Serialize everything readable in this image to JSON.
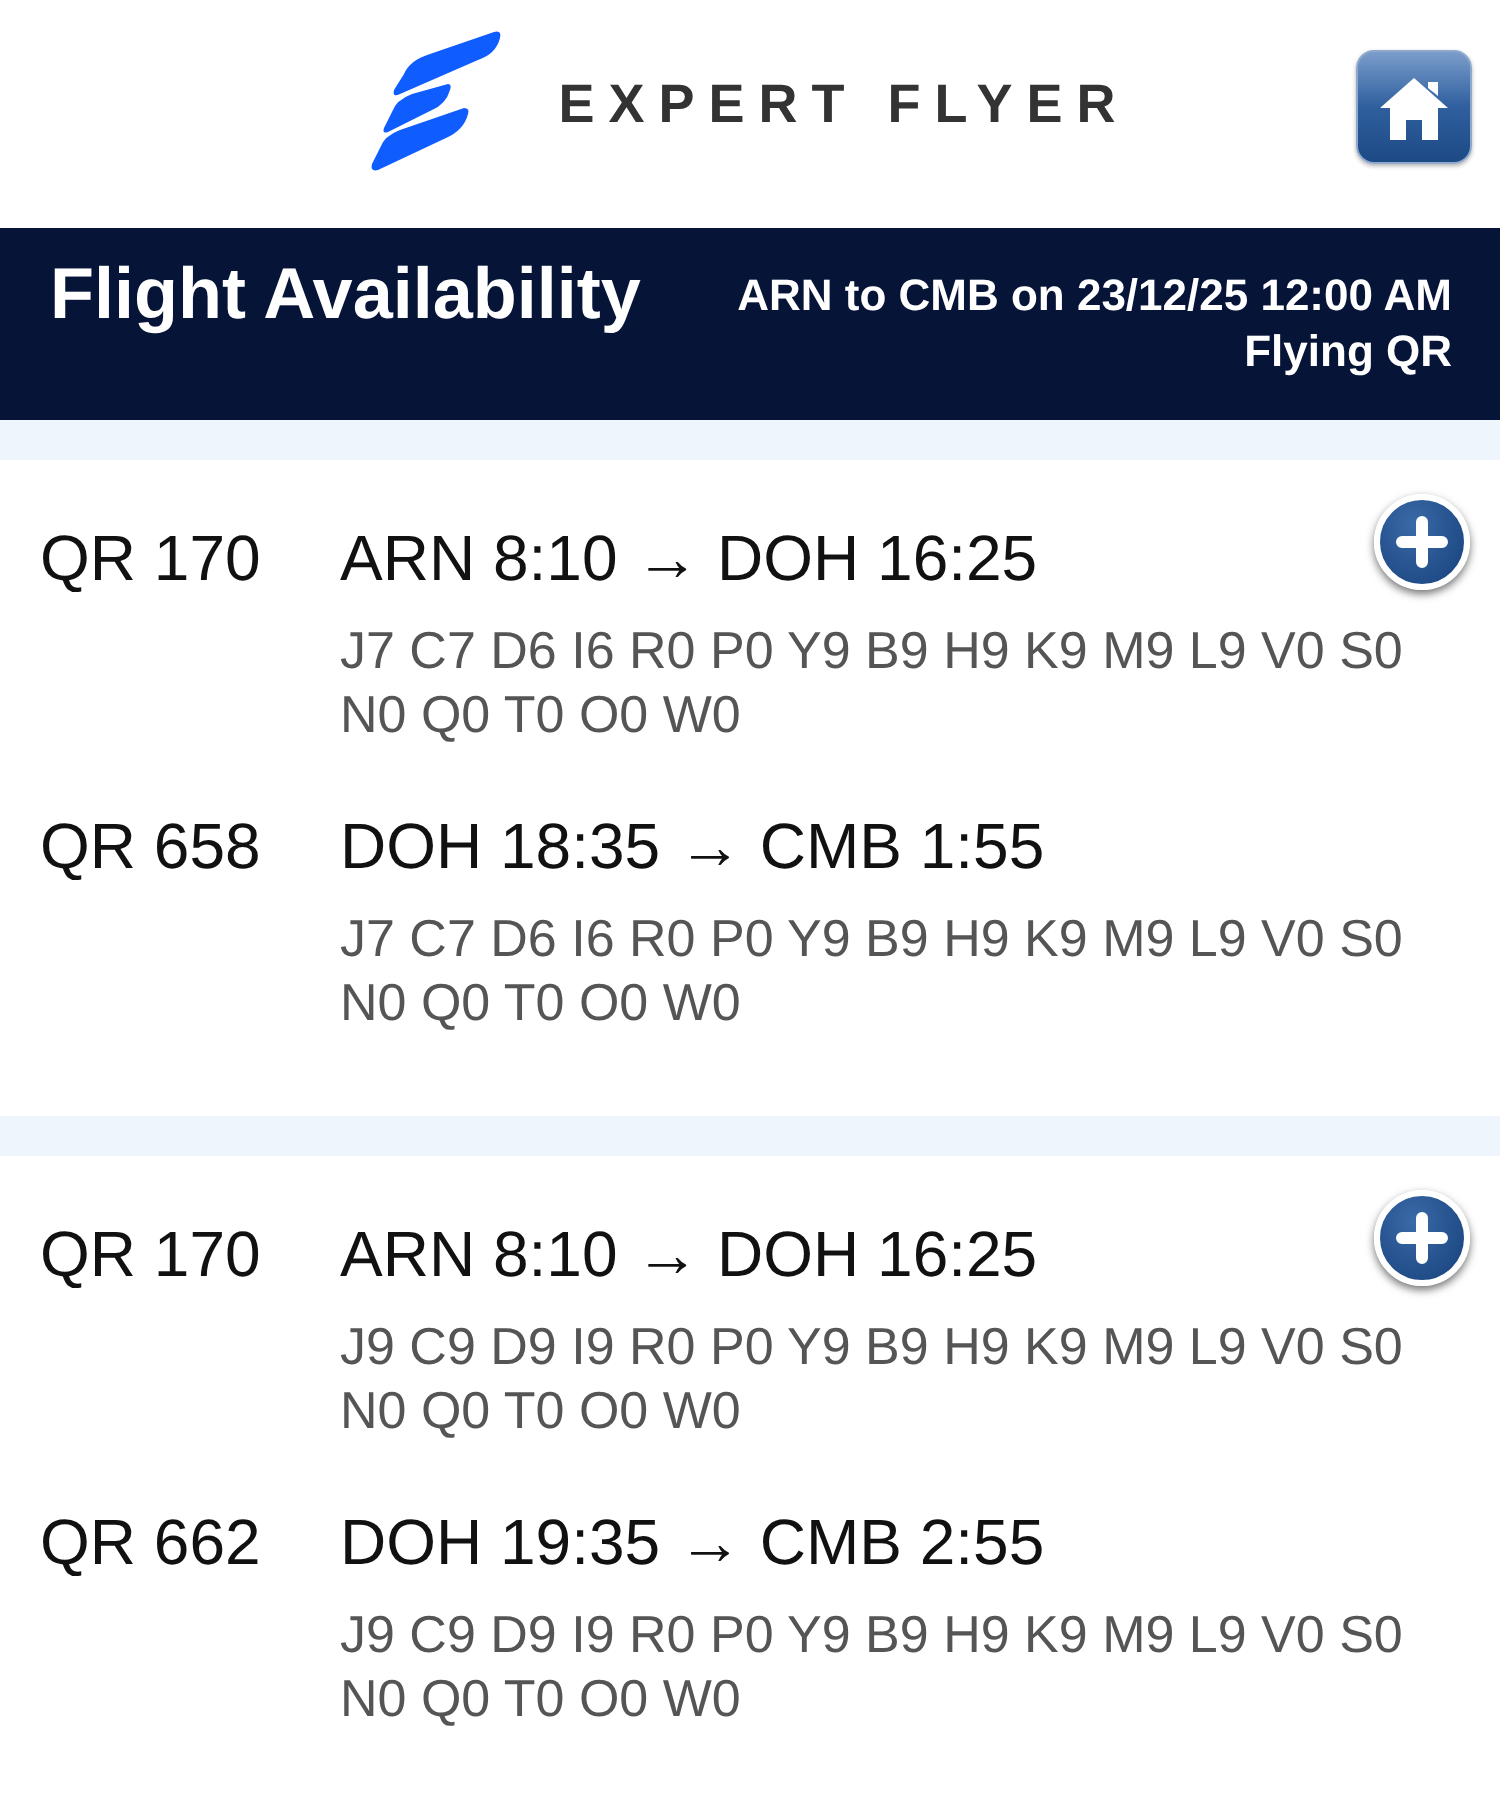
{
  "header": {
    "brand": "EXPERT FLYER"
  },
  "title_bar": {
    "title": "Flight Availability",
    "route": "ARN to CMB on 23/12/25 12:00 AM",
    "carrier": "Flying QR"
  },
  "itineraries": [
    {
      "segments": [
        {
          "flight": "QR 170",
          "route": "ARN 8:10 → DOH 16:25",
          "classes": "J7 C7 D6 I6 R0 P0 Y9 B9 H9 K9 M9 L9 V0 S0 N0 Q0 T0 O0 W0"
        },
        {
          "flight": "QR 658",
          "route": "DOH 18:35 → CMB 1:55",
          "classes": "J7 C7 D6 I6 R0 P0 Y9 B9 H9 K9 M9 L9 V0 S0 N0 Q0 T0 O0 W0"
        }
      ]
    },
    {
      "segments": [
        {
          "flight": "QR 170",
          "route": "ARN 8:10 → DOH 16:25",
          "classes": "J9 C9 D9 I9 R0 P0 Y9 B9 H9 K9 M9 L9 V0 S0 N0 Q0 T0 O0 W0"
        },
        {
          "flight": "QR 662",
          "route": "DOH 19:35 → CMB 2:55",
          "classes": "J9 C9 D9 I9 R0 P0 Y9 B9 H9 K9 M9 L9 V0 S0 N0 Q0 T0 O0 W0"
        }
      ]
    }
  ]
}
